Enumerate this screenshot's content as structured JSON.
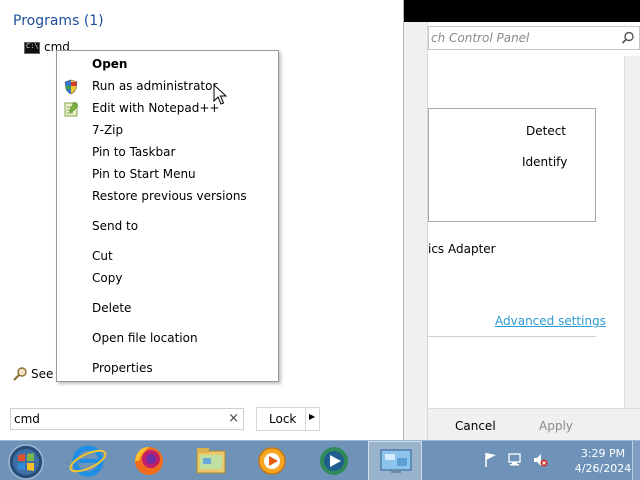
{
  "control_panel": {
    "search_placeholder": "ch Control Panel",
    "detect_label": "Detect",
    "identify_label": "Identify",
    "adapter_label": "ics Adapter",
    "advanced_settings_link": "Advanced settings",
    "cancel_label": "Cancel",
    "apply_label": "Apply"
  },
  "start_menu": {
    "programs_header": "Programs (1)",
    "program_item": "cmd",
    "program_icon_text": "C:\\",
    "see_more": "See r",
    "search_value": "cmd",
    "search_clear": "×",
    "lock_label": "Lock",
    "lock_arrow": "▶"
  },
  "context_menu": {
    "items": [
      {
        "label": "Open"
      },
      {
        "label": "Run as administrator"
      },
      {
        "label": "Edit with Notepad++"
      },
      {
        "label": "7-Zip"
      },
      {
        "label": "Pin to Taskbar"
      },
      {
        "label": "Pin to Start Menu"
      },
      {
        "label": "Restore previous versions"
      },
      {
        "label": "Send to"
      },
      {
        "label": "Cut"
      },
      {
        "label": "Copy"
      },
      {
        "label": "Delete"
      },
      {
        "label": "Open file location"
      },
      {
        "label": "Properties"
      }
    ]
  },
  "taskbar": {
    "clock_time": "3:29 PM",
    "clock_date": "4/26/2024",
    "icons": [
      "start-orb-icon",
      "internet-explorer-icon",
      "firefox-icon",
      "file-explorer-icon",
      "media-player-icon",
      "media-center-icon",
      "display-settings-icon"
    ]
  }
}
